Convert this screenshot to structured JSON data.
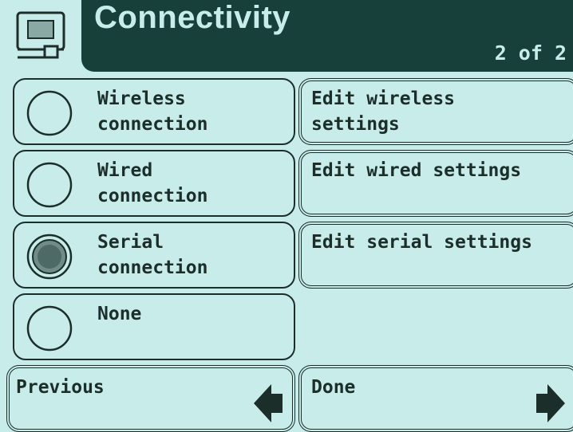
{
  "header": {
    "title": "Connectivity",
    "page_indicator": "2 of 2",
    "icon": "display-icon"
  },
  "options": [
    {
      "label": "Wireless\nconnection",
      "selected": false,
      "edit_label": "Edit wireless\nsettings"
    },
    {
      "label": "Wired\nconnection",
      "selected": false,
      "edit_label": "Edit wired settings"
    },
    {
      "label": "Serial\nconnection",
      "selected": true,
      "edit_label": "Edit serial settings"
    },
    {
      "label": "None",
      "selected": false
    }
  ],
  "footer": {
    "previous_label": "Previous",
    "done_label": "Done"
  },
  "colors": {
    "background": "#c8ecea",
    "header": "#17403a",
    "ink": "#1b2e2a"
  }
}
